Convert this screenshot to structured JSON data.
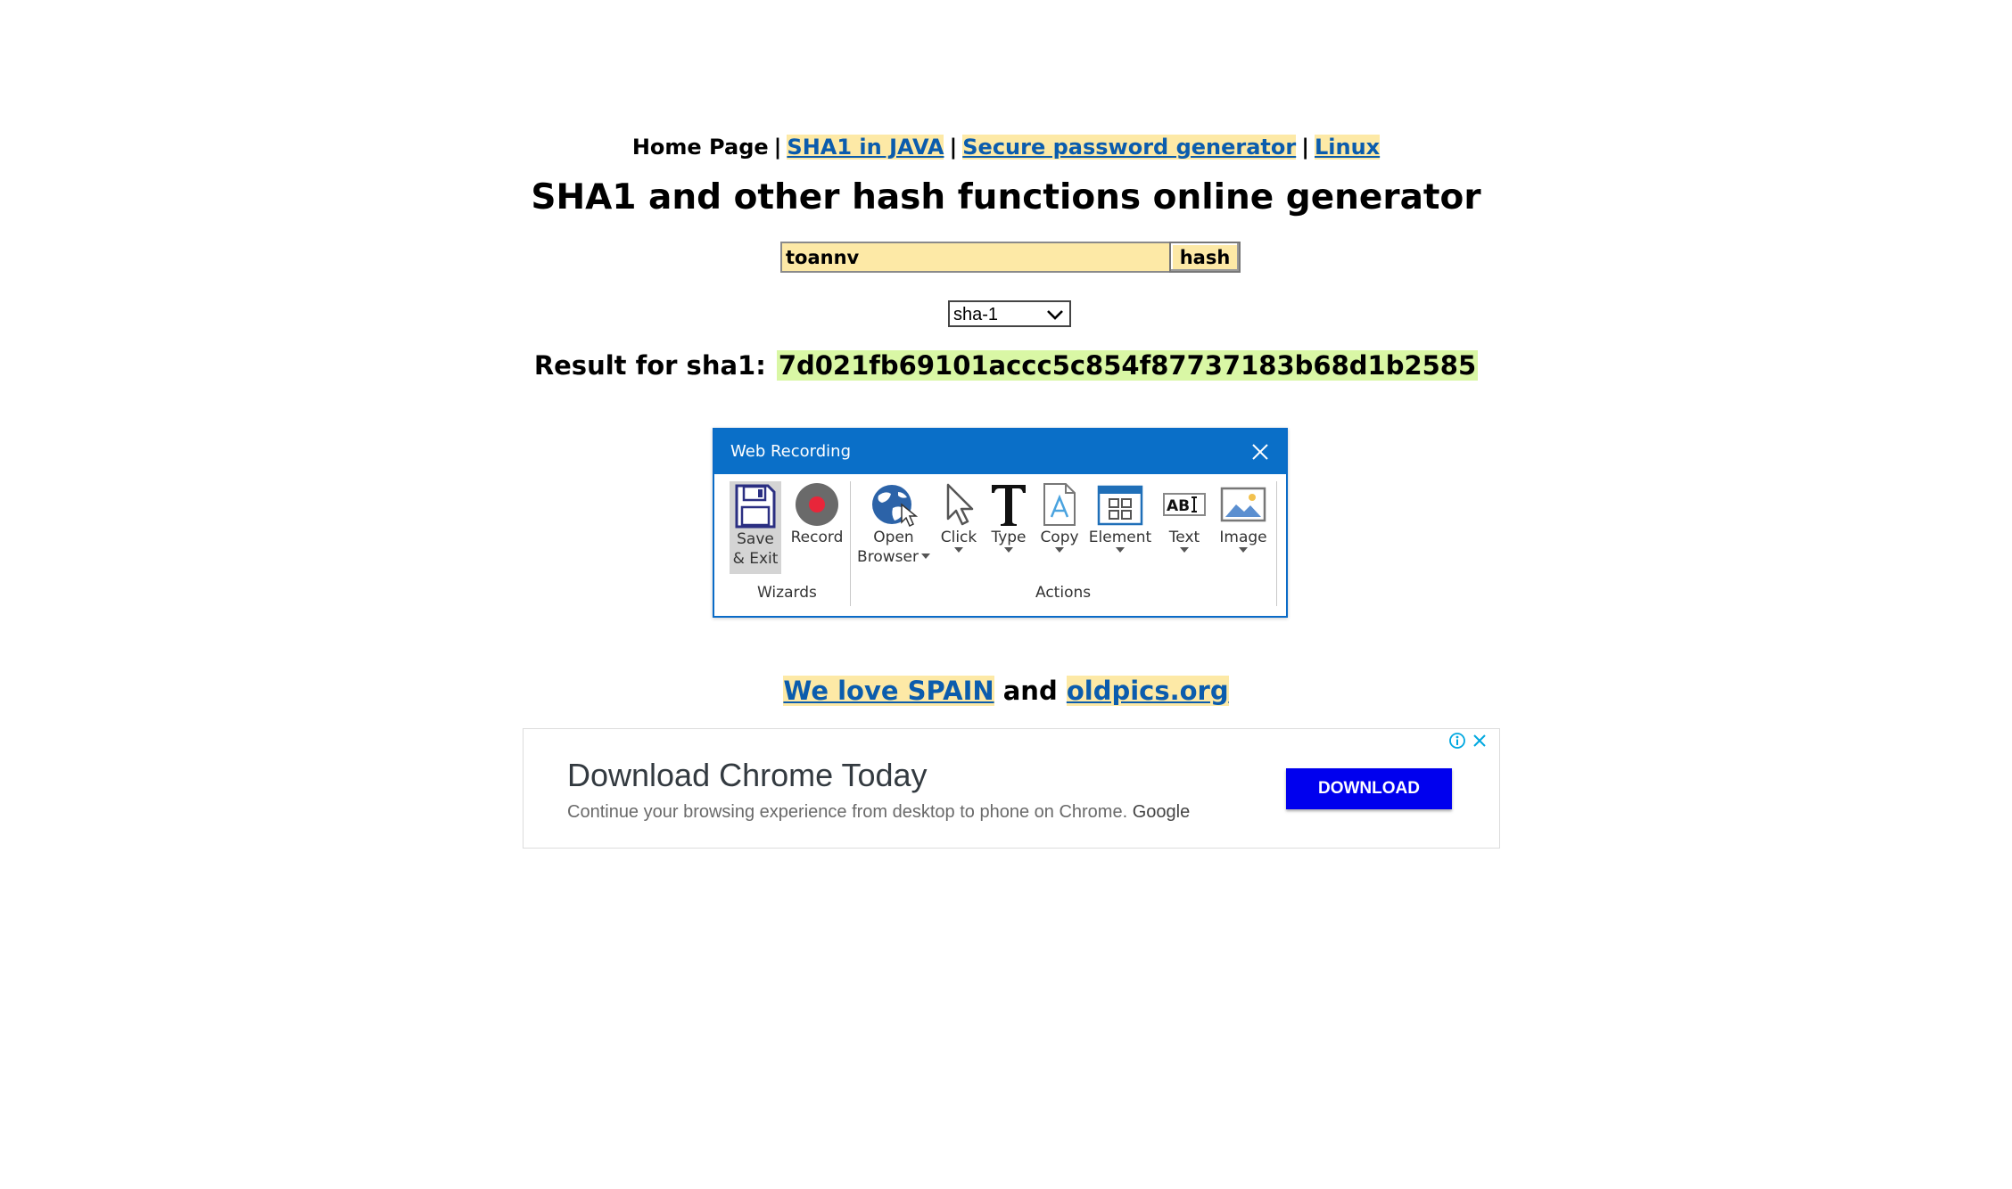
{
  "nav": {
    "home": "Home Page",
    "separator": "|",
    "links": [
      "SHA1 in JAVA",
      "Secure password generator",
      "Linux"
    ]
  },
  "page_title": "SHA1 and other hash functions online generator",
  "form": {
    "input_value": "toannv",
    "hash_button": "hash",
    "algorithm": "sha-1"
  },
  "result": {
    "label": "Result for sha1:",
    "value": "7d021fb69101accc5c854f87737183b68d1b2585"
  },
  "dialog": {
    "title": "Web Recording",
    "tools": {
      "save_line1": "Save",
      "save_line2": "& Exit",
      "record": "Record",
      "open_line1": "Open",
      "open_line2": "Browser",
      "click": "Click",
      "type": "Type",
      "copy": "Copy",
      "element": "Element",
      "text": "Text",
      "image": "Image"
    },
    "groups": {
      "wizards": "Wizards",
      "actions": "Actions"
    },
    "colors": {
      "titlebar": "#0a6fc8",
      "record": "#e8263a"
    }
  },
  "footer": {
    "link1": "We love SPAIN",
    "conjunction": "and",
    "link2": "oldpics.org"
  },
  "ad": {
    "title": "Download Chrome Today",
    "description": "Continue your browsing experience from desktop to phone on Chrome.",
    "brand": "Google",
    "button": "DOWNLOAD",
    "icons": [
      "info-icon",
      "close-icon"
    ]
  }
}
